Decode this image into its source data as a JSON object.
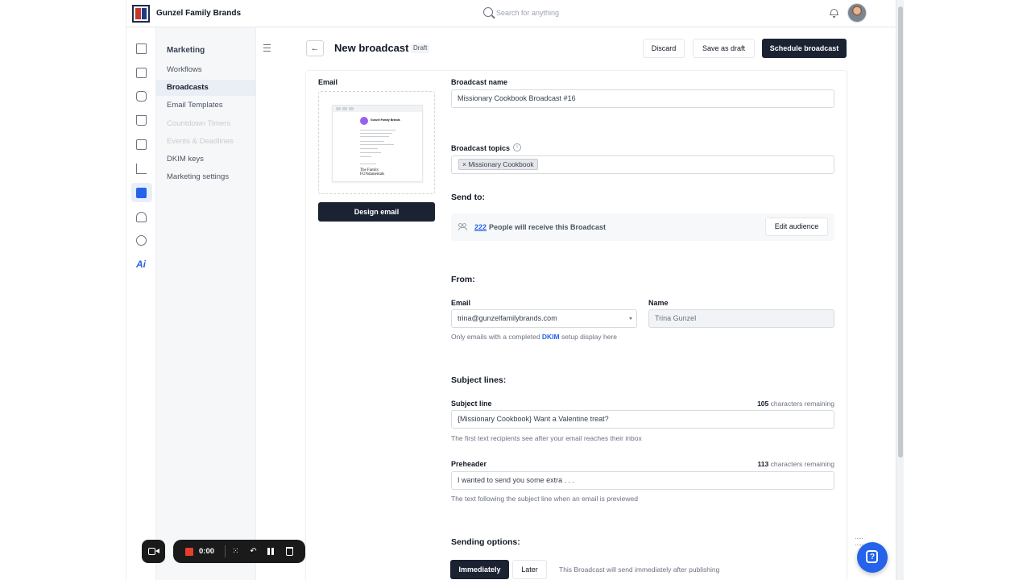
{
  "topbar": {
    "brand": "Gunzel Family Brands",
    "search_placeholder": "Search for anything"
  },
  "rail": {
    "icons": [
      "home-icon",
      "inbox-icon",
      "contacts-icon",
      "cart-icon",
      "id-card-icon",
      "analytics-icon",
      "marketing-icon",
      "automation-icon",
      "settings-icon",
      "ai-icon"
    ],
    "ai_label": "Ai",
    "active": "marketing-icon"
  },
  "subnav": {
    "title": "Marketing",
    "items": [
      {
        "label": "Workflows"
      },
      {
        "label": "Broadcasts"
      },
      {
        "label": "Email Templates"
      },
      {
        "label": "Countdown Timers"
      },
      {
        "label": "Events & Deadlines"
      },
      {
        "label": "DKIM keys"
      },
      {
        "label": "Marketing settings"
      }
    ]
  },
  "header": {
    "back_glyph": "←",
    "title": "New broadcast",
    "badge": "Draft",
    "discard": "Discard",
    "save_draft": "Save as draft",
    "schedule": "Schedule broadcast"
  },
  "email_panel": {
    "label": "Email",
    "design_button": "Design email",
    "preview_header": "Gunzel Family Brands",
    "preview_footer_line1": "The Family",
    "preview_footer_line2": "FUNdamentals"
  },
  "form": {
    "broadcast_name_label": "Broadcast name",
    "broadcast_name_value": "Missionary Cookbook Broadcast #16",
    "topics_label": "Broadcast topics",
    "info_glyph": "i",
    "topic_chip": "× Missionary Cookbook",
    "send_to_heading": "Send to:",
    "audience_count": "222",
    "audience_text": "People will receive this Broadcast",
    "edit_audience": "Edit audience",
    "from_heading": "From:",
    "email_label": "Email",
    "email_value": "trina@gunzelfamilybrands.com",
    "name_label": "Name",
    "name_value": "Trina Gunzel",
    "dkim_help_pre": "Only emails with a completed",
    "dkim_help_link": "DKIM",
    "dkim_help_post": "setup display here",
    "subject_heading": "Subject lines:",
    "subject_label": "Subject line",
    "subject_remaining_count": "105",
    "remaining_suffix": "characters remaining",
    "subject_value": "{Missionary Cookbook} Want a Valentine treat?",
    "subject_help": "The first text recipients see after your email reaches their inbox",
    "preheader_label": "Preheader",
    "preheader_remaining_count": "113",
    "preheader_value": "I wanted to send you some extra . . .",
    "preheader_help": "The text following the subject line when an email is previewed",
    "sending_heading": "Sending options:",
    "immediately": "Immediately",
    "later": "Later",
    "sending_help": "This Broadcast will send immediately after publishing"
  },
  "recorder": {
    "time": "0:00"
  },
  "colors": {
    "primary_dark": "#1b2333",
    "link_blue": "#2563eb",
    "record_red": "#e53e2e"
  }
}
